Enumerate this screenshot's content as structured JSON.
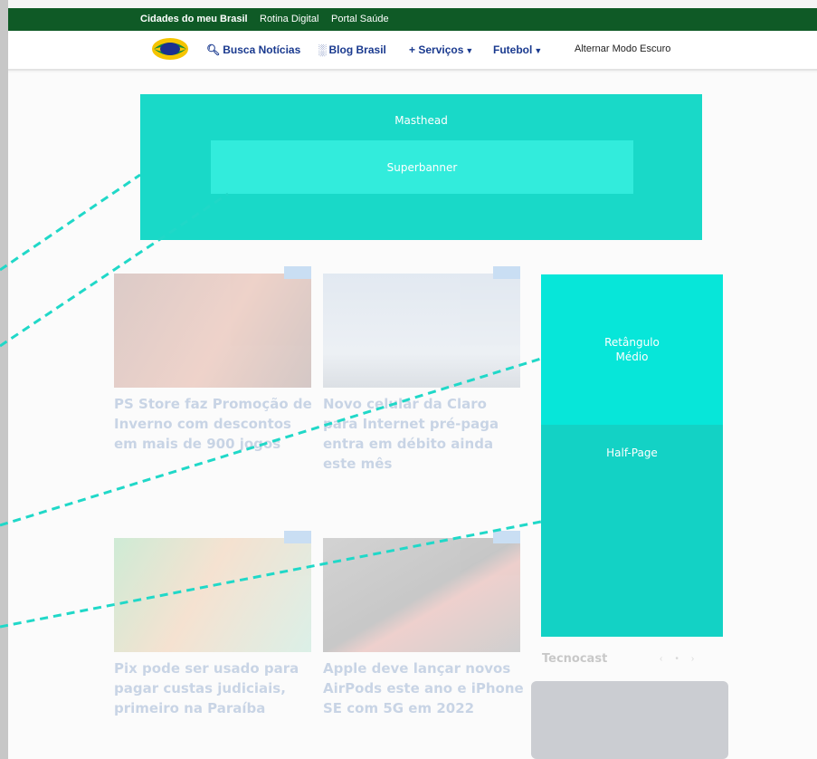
{
  "topbar": {
    "links": [
      "Cidades do meu Brasil",
      "Rotina Digital",
      "Portal Saúde"
    ]
  },
  "navbar": {
    "search_label": "Busca Notícias",
    "blog_label": "Blog Brasil",
    "services_label": "+ Serviços",
    "football_label": "Futebol",
    "dark_mode_label": "Alternar Modo Escuro"
  },
  "ads": {
    "masthead": "Masthead",
    "superbanner": "Superbanner",
    "retangulo": "Retângulo Médio",
    "halfpage": "Half-Page"
  },
  "articles": [
    {
      "title": "PS Store faz Promoção de Inverno com descontos em mais de 900 jogos",
      "meta": "",
      "excerpt": ""
    },
    {
      "title": "Novo celular da Claro para Internet pré-paga entra em débito ainda este mês",
      "meta": "",
      "excerpt": ""
    },
    {
      "title": "Pix pode ser usado para pagar custas judiciais, primeiro na Paraíba",
      "meta": "",
      "excerpt": ""
    },
    {
      "title": "Apple deve lançar novos AirPods este ano e iPhone SE com 5G em 2022",
      "meta": "",
      "excerpt": ""
    }
  ],
  "sidebar": {
    "tecnocast_title": "Tecnocast"
  },
  "colors": {
    "topbar": "#0f5a26",
    "nav_link": "#1a3a8f",
    "ad_teal": "#19d9c8",
    "guide_line": "#20d8c8"
  }
}
